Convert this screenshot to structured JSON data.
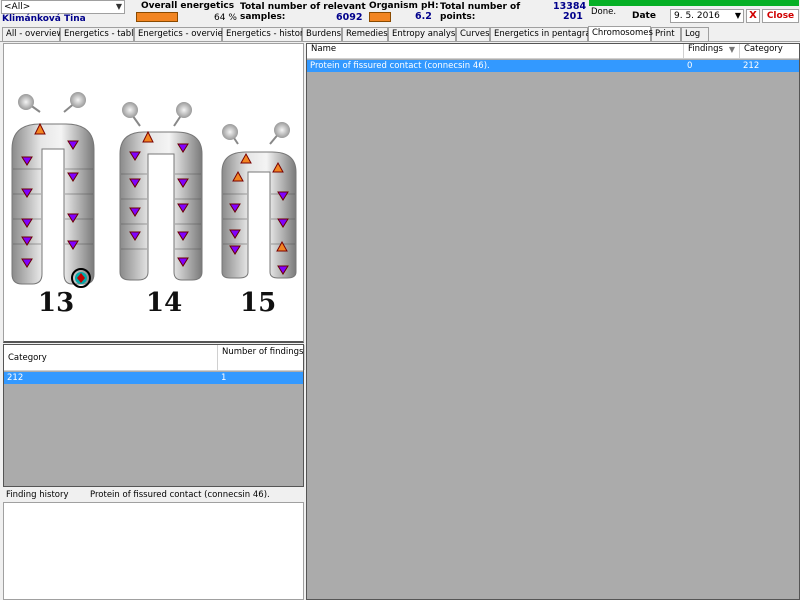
{
  "header": {
    "filter_value": "<All>",
    "patient_name": "Klimánková Tina",
    "overall_energetics_label": "Overall energetics",
    "overall_energetics_percent": "64 %",
    "overall_energetics_fraction": 0.64,
    "relevant_samples_label_1": "Total number of relevant",
    "relevant_samples_label_2": "samples:",
    "relevant_samples_value": "6092",
    "ph_label": "Organism pH:",
    "ph_value": "6.2",
    "points_label_1": "Total number of",
    "points_label_2": "points:",
    "points_value_top": "13384",
    "points_value": "201",
    "status": "Done.",
    "date_label": "Date",
    "date_value": "9. 5. 2016",
    "x_label": "X",
    "close_label": "Close"
  },
  "tabs": [
    {
      "label": "All - overview"
    },
    {
      "label": "Energetics - table"
    },
    {
      "label": "Energetics - overview"
    },
    {
      "label": "Energetics - history"
    },
    {
      "label": "Burdens"
    },
    {
      "label": "Remedies"
    },
    {
      "label": "Entropy analysis"
    },
    {
      "label": "Curves"
    },
    {
      "label": "Energetics in pentagram"
    },
    {
      "label": "Chromosomes",
      "active": true
    },
    {
      "label": "Print"
    },
    {
      "label": "Log"
    }
  ],
  "chromosomes": {
    "labels": [
      "13",
      "14",
      "15"
    ]
  },
  "category_grid": {
    "headers": [
      "Category",
      "Number of findings"
    ],
    "rows": [
      [
        "212",
        "1"
      ]
    ]
  },
  "history": {
    "label": "Finding history",
    "value": "Protein of fissured contact (connecsin 46)."
  },
  "findings_grid": {
    "headers": [
      "Name",
      "Findings",
      "Category"
    ],
    "sort_indicator": "▼",
    "rows": [
      [
        "Protein of fissured contact (connecsin 46).",
        "0",
        "212"
      ]
    ]
  },
  "colors": {
    "accent_orange": "#f28522",
    "selection_blue": "#3399ff",
    "progress_green": "#06b025",
    "close_red": "#d00000",
    "value_blue": "#00008b"
  }
}
